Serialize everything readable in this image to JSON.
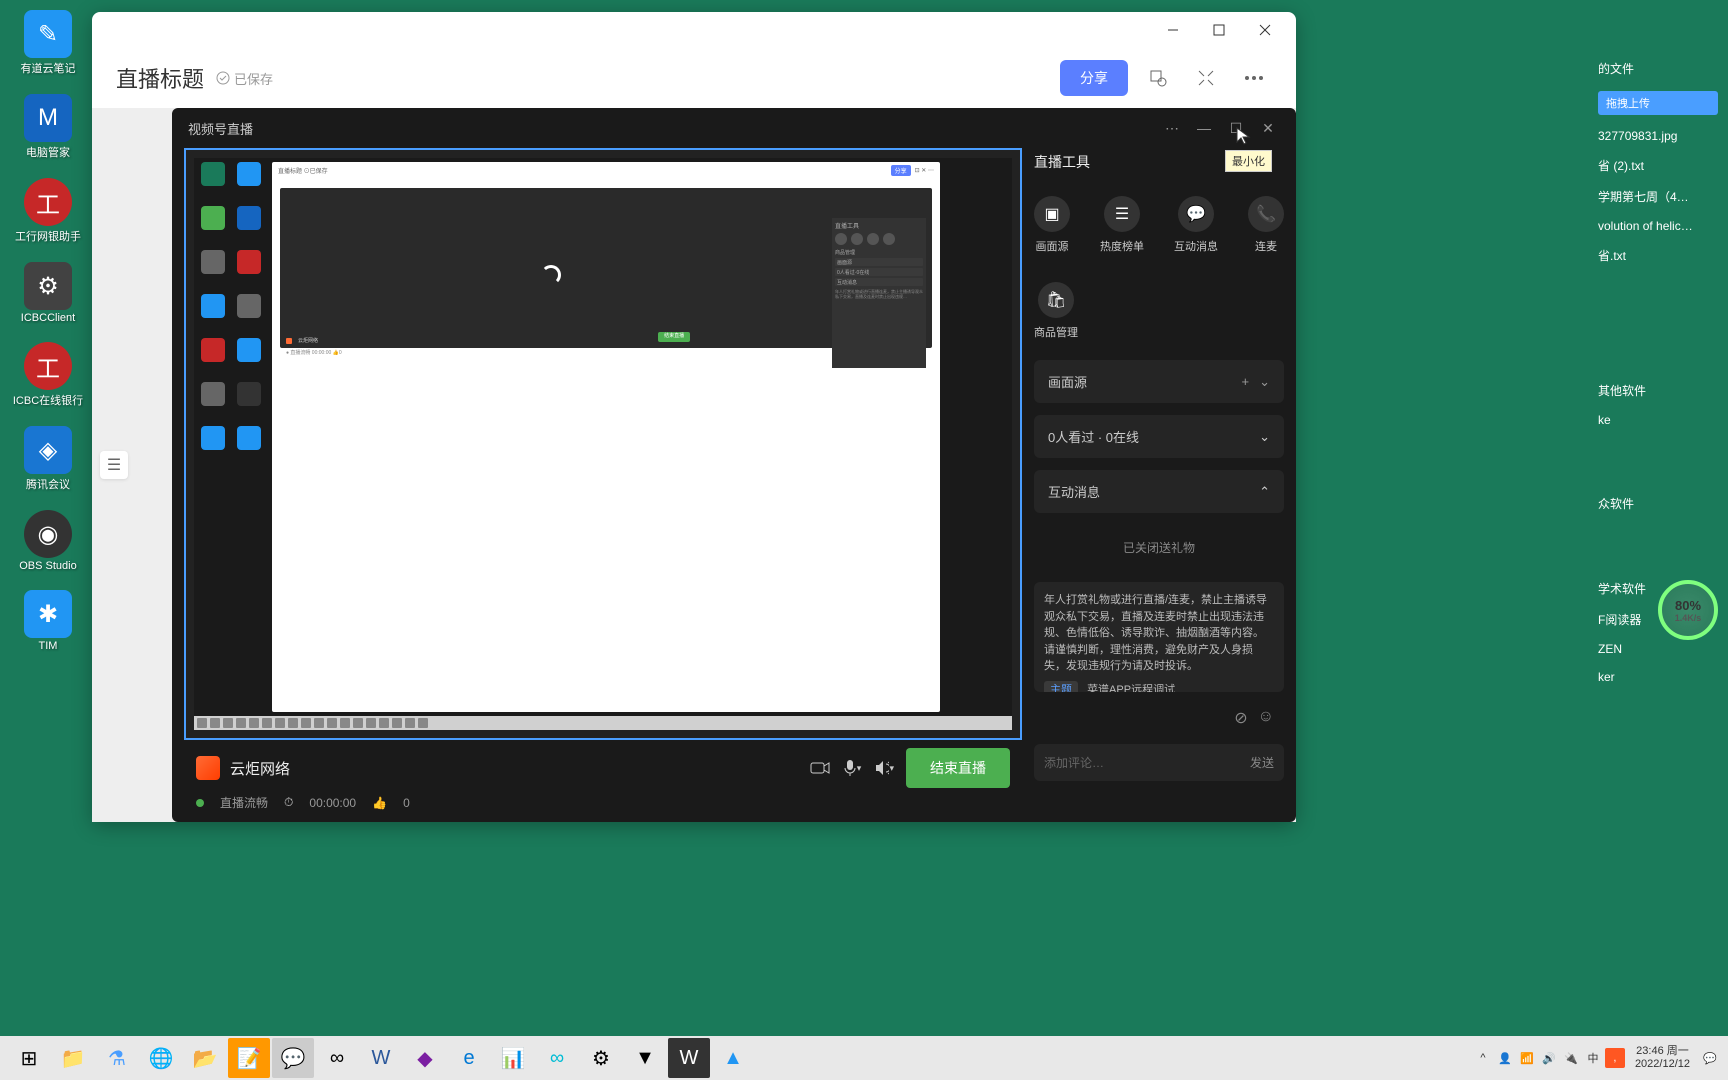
{
  "desktop_icons": [
    {
      "label": "有道云笔记",
      "bg": "#2196f3"
    },
    {
      "label": "电脑管家",
      "bg": "#1565c0"
    },
    {
      "label": "工行网银助手",
      "bg": "#c62828"
    },
    {
      "label": "ICBCClient",
      "bg": "#424242"
    },
    {
      "label": "ICBC在线银行",
      "bg": "#c62828"
    },
    {
      "label": "腾讯会议",
      "bg": "#1976d2"
    },
    {
      "label": "OBS Studio",
      "bg": "#333333"
    },
    {
      "label": "TIM",
      "bg": "#2196f3"
    }
  ],
  "desktop_files": [
    "的文件",
    "327709831.jpg",
    "省 (2).txt",
    "学期第七周（4…",
    "volution of helic…",
    "省.txt",
    "其他软件",
    "ke",
    "众软件",
    "学术软件",
    "F阅读器",
    "ZEN",
    "ker"
  ],
  "upload_label": "拖拽上传",
  "gauge": {
    "percent": "80%",
    "speed": "1.4K/s"
  },
  "main": {
    "title": "直播标题",
    "saved": "已保存",
    "share": "分享"
  },
  "stream": {
    "header": "视频号直播",
    "tooltip": "最小化",
    "channel": "云炬网络",
    "status": "直播流畅",
    "duration": "00:00:00",
    "likes": "0",
    "end_button": "结束直播"
  },
  "sidebar": {
    "title": "直播工具",
    "tools": [
      {
        "label": "画面源",
        "icon": "▢"
      },
      {
        "label": "热度榜单",
        "icon": "☰"
      },
      {
        "label": "互动消息",
        "icon": "💬"
      },
      {
        "label": "连麦",
        "icon": "📞"
      }
    ],
    "tool2": {
      "label": "商品管理",
      "icon": "🛍"
    },
    "card_source": "画面源",
    "card_viewers": "0人看过 · 0在线",
    "card_messages": "互动消息",
    "gift_closed": "已关闭送礼物",
    "notice": "年人打赏礼物或进行直播/连麦，禁止主播诱导观众私下交易，直播及连麦时禁止出现违法违规、色情低俗、诱导欺诈、抽烟酗酒等内容。请谨慎判断，理性消费，避免财产及人身损失，发现违规行为请及时投诉。",
    "topic_label": "主题",
    "topic": "菜谱APP远程调试",
    "comment_placeholder": "添加评论…",
    "send": "发送"
  },
  "taskbar": {
    "time": "23:46 周一",
    "date": "2022/12/12"
  }
}
